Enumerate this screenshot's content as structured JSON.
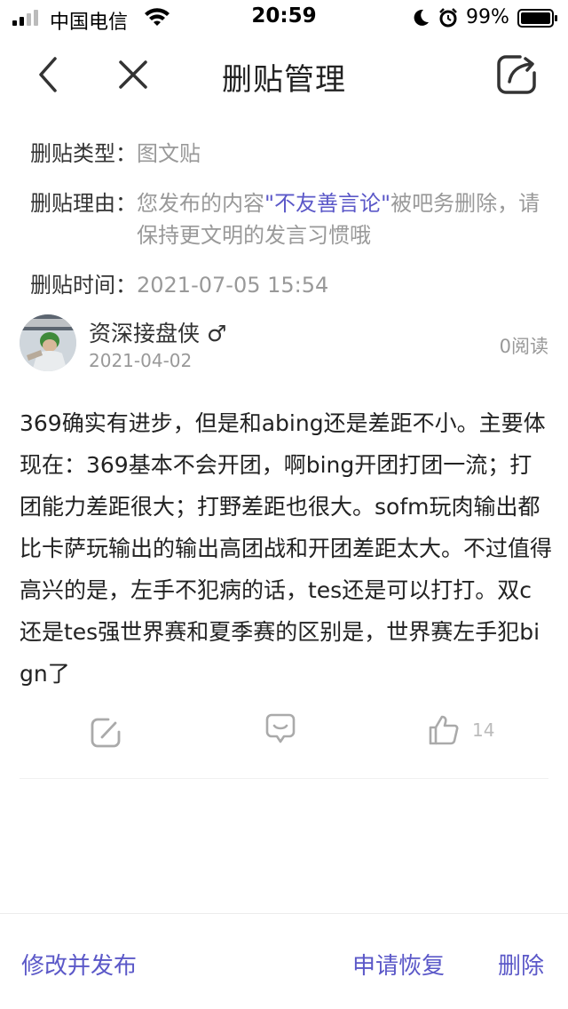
{
  "status_bar": {
    "carrier": "中国电信",
    "time": "20:59",
    "battery": "99%"
  },
  "nav": {
    "title": "删贴管理",
    "icons": [
      "back-icon",
      "close-icon",
      "share-icon"
    ]
  },
  "info": {
    "type_label": "删贴类型：",
    "type_value": "图文贴",
    "reason_label": "删贴理由：",
    "reason_prefix": "您发布的内容",
    "reason_quote": "\"不友善言论\"",
    "reason_suffix": "被吧务删除，请保持更文明的发言习惯哦",
    "time_label": "删贴时间：",
    "time_value": "2021-07-05 15:54"
  },
  "post": {
    "author": "资深接盘侠",
    "gender_symbol": "♂",
    "date": "2021-04-02",
    "read_count": "0阅读",
    "text": "369确实有进步，但是和abing还是差距不小。主要体现在：369基本不会开团，啊bing开团打团一流；打团能力差距很大；打野差距也很大。sofm玩肉输出都比卡萨玩输出的输出高团战和开团差距太大。不过值得高兴的是，左手不犯病的话，tes还是可以打打。双c还是tes强世界赛和夏季赛的区别是，世界赛左手犯bign了",
    "like_count": "14"
  },
  "bottom_bar": {
    "edit_label": "修改并发布",
    "restore_label": "申请恢复",
    "delete_label": "删除"
  },
  "colors": {
    "accent": "#5b58c8",
    "muted": "#999999",
    "text": "#222222"
  }
}
